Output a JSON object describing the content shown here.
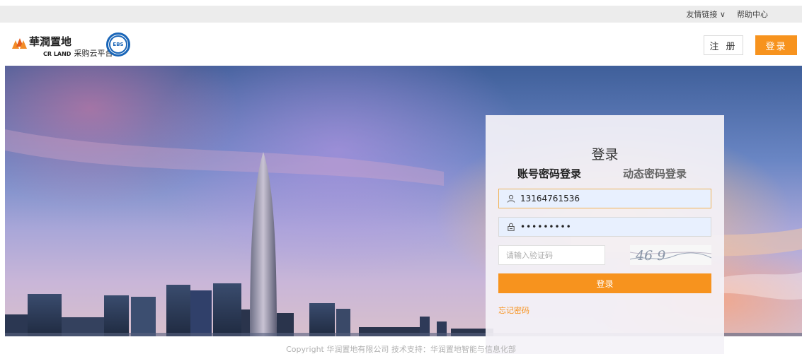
{
  "topbar": {
    "friend_links": "友情链接 ∨",
    "help_center": "帮助中心"
  },
  "header": {
    "logo_cn": "華潤置地",
    "logo_en": "CR LAND",
    "logo_sub": "采购云平台",
    "ebs_badge": "EBS",
    "register_label": "注 册",
    "login_label": "登录"
  },
  "login": {
    "title": "登录",
    "tab_password": "账号密码登录",
    "tab_dynamic": "动态密码登录",
    "username_value": "13164761536",
    "password_mask": "•••••••••",
    "captcha_placeholder": "请输入验证码",
    "captcha_text": "46 9",
    "submit_label": "登录",
    "forgot_label": "忘记密码"
  },
  "footer": {
    "copyright": "Copyright 华润置地有限公司 技术支持：华润置地智能与信息化部"
  },
  "colors": {
    "accent": "#f7931e",
    "brand_blue": "#1a66b8"
  }
}
